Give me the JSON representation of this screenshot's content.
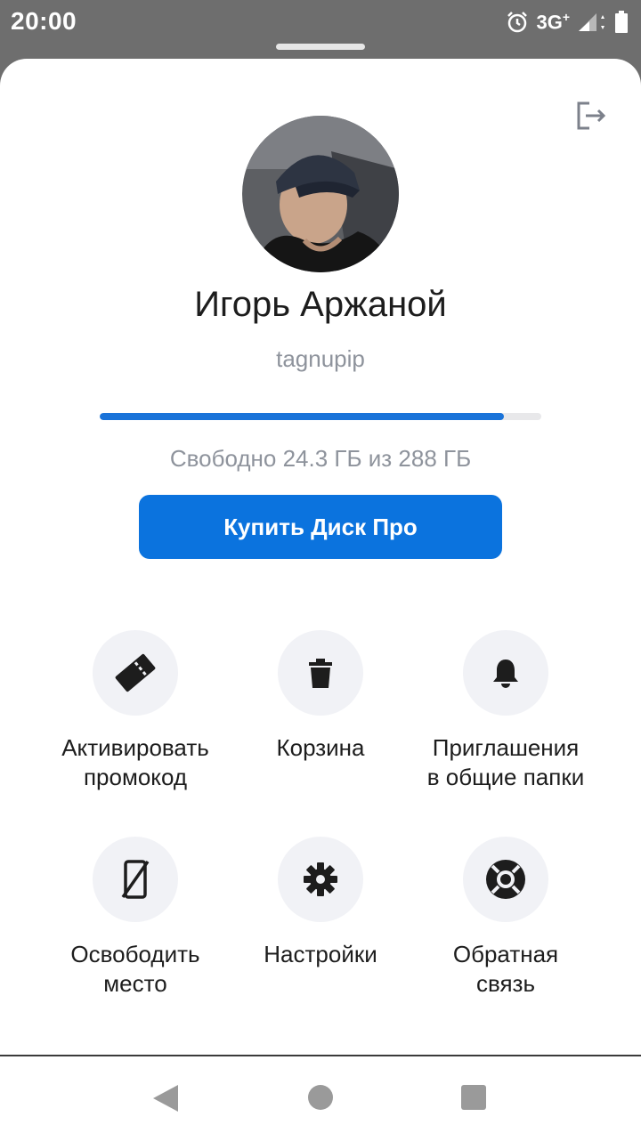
{
  "status_bar": {
    "time": "20:00",
    "network": "3G",
    "network_plus": "+",
    "icons": [
      "alarm-icon",
      "signal-icon",
      "battery-icon"
    ]
  },
  "profile": {
    "name": "Игорь Аржаной",
    "login": "tagnupip",
    "storage_text": "Свободно 24.3 ГБ из 288 ГБ",
    "storage_used_fraction": 0.916
  },
  "buy_button_label": "Купить Диск Про",
  "actions": [
    {
      "icon": "promo-ticket-icon",
      "label": "Активировать\nпромокод"
    },
    {
      "icon": "trash-icon",
      "label": "Корзина"
    },
    {
      "icon": "bell-icon",
      "label": "Приглашения\nв общие папки"
    },
    {
      "icon": "free-space-phone-icon",
      "label": "Освободить\nместо"
    },
    {
      "icon": "gear-icon",
      "label": "Настройки"
    },
    {
      "icon": "lifebuoy-icon",
      "label": "Обратная\nсвязь"
    }
  ],
  "colors": {
    "accent": "#0b73de",
    "progress_fill": "#1a73d9",
    "secondary_text": "#8e939c",
    "tile_bg": "#f1f2f6"
  },
  "nav": [
    "back-icon",
    "home-icon",
    "recents-icon"
  ]
}
